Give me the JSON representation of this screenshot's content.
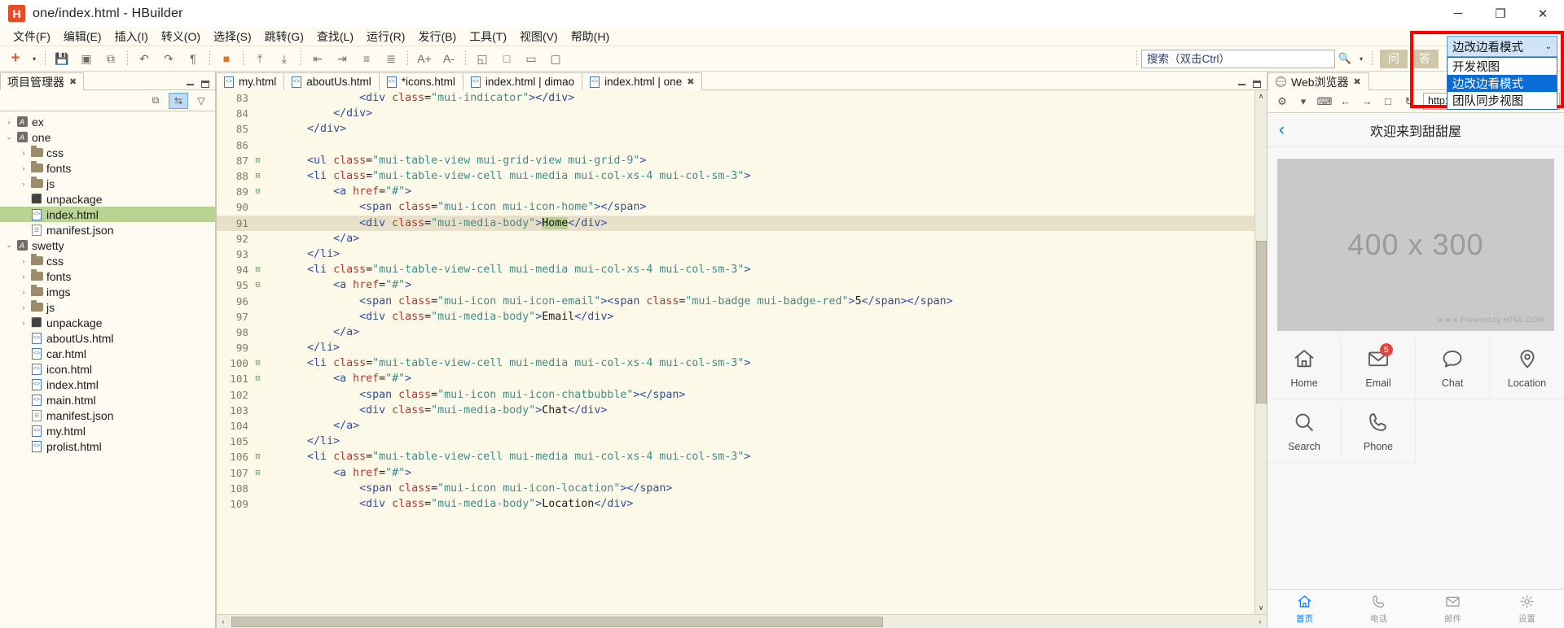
{
  "window": {
    "logo_text": "H",
    "title": "one/index.html  -  HBuilder",
    "minimize": "─",
    "maximize": "❐",
    "close": "✕"
  },
  "menubar": {
    "items": [
      "文件(F)",
      "编辑(E)",
      "插入(I)",
      "转义(O)",
      "选择(S)",
      "跳转(G)",
      "查找(L)",
      "运行(R)",
      "发行(B)",
      "工具(T)",
      "视图(V)",
      "帮助(H)"
    ]
  },
  "toolbar": {
    "new_label": "+",
    "dropdown_caret": "▾",
    "buttons": [
      {
        "name": "save-button",
        "glyph": "💾"
      },
      {
        "name": "save-all-button",
        "glyph": "▣"
      },
      {
        "name": "save-as-button",
        "glyph": "⧉"
      },
      {
        "name": "undo-button",
        "glyph": "↶"
      },
      {
        "name": "redo-button",
        "glyph": "↷"
      },
      {
        "name": "format-button",
        "glyph": "¶"
      },
      {
        "name": "bookmark-button",
        "glyph": "■"
      },
      {
        "name": "goto-prev-bookmark-button",
        "glyph": "⤒"
      },
      {
        "name": "goto-next-bookmark-button",
        "glyph": "⤓"
      },
      {
        "name": "outdent-button",
        "glyph": "⇤"
      },
      {
        "name": "indent-button",
        "glyph": "⇥"
      },
      {
        "name": "comment-button",
        "glyph": "≡"
      },
      {
        "name": "uncomment-button",
        "glyph": "≣"
      },
      {
        "name": "font-increase-button",
        "glyph": "A+"
      },
      {
        "name": "font-decrease-button",
        "glyph": "A-"
      },
      {
        "name": "browser-run-button",
        "glyph": "◱"
      },
      {
        "name": "preview-button",
        "glyph": "□"
      },
      {
        "name": "mobile-run-button",
        "glyph": "▭"
      },
      {
        "name": "device-button",
        "glyph": "▢"
      }
    ],
    "search_placeholder": "搜索（双击Ctrl）",
    "search_value": "搜索（双击Ctrl）",
    "search_icon": "🔍",
    "search_caret": "▾",
    "right_buttons": [
      "问",
      "答"
    ]
  },
  "mode_dropdown": {
    "selected": "边改边看模式",
    "caret": "⌄",
    "options": [
      "开发视图",
      "边改边看模式",
      "团队同步视图"
    ],
    "selected_index": 1,
    "highlight_color": "#0a6cd6",
    "annotation_color": "#ff0000"
  },
  "left_panel": {
    "tab_title": "项目管理器",
    "tab_close": "✖",
    "toolbar_buttons": [
      {
        "name": "collapse-all-button",
        "glyph": "⧉"
      },
      {
        "name": "link-with-editor-button",
        "glyph": "⇆",
        "active": true
      },
      {
        "name": "view-menu-button",
        "glyph": "▽"
      }
    ],
    "tree": [
      {
        "depth": 0,
        "twisty": "›",
        "icon": "project",
        "label": "ex",
        "selected": false
      },
      {
        "depth": 0,
        "twisty": "⌄",
        "icon": "project",
        "label": "one",
        "selected": false
      },
      {
        "depth": 1,
        "twisty": "›",
        "icon": "folder",
        "label": "css",
        "selected": false
      },
      {
        "depth": 1,
        "twisty": "›",
        "icon": "folder",
        "label": "fonts",
        "selected": false
      },
      {
        "depth": 1,
        "twisty": "›",
        "icon": "folder",
        "label": "js",
        "selected": false
      },
      {
        "depth": 1,
        "twisty": "",
        "icon": "box",
        "label": "unpackage",
        "selected": false
      },
      {
        "depth": 1,
        "twisty": "",
        "icon": "html",
        "label": "index.html",
        "selected": true
      },
      {
        "depth": 1,
        "twisty": "",
        "icon": "json",
        "label": "manifest.json",
        "selected": false
      },
      {
        "depth": 0,
        "twisty": "⌄",
        "icon": "project",
        "label": "swetty",
        "selected": false
      },
      {
        "depth": 1,
        "twisty": "›",
        "icon": "folder",
        "label": "css",
        "selected": false
      },
      {
        "depth": 1,
        "twisty": "›",
        "icon": "folder",
        "label": "fonts",
        "selected": false
      },
      {
        "depth": 1,
        "twisty": "›",
        "icon": "folder",
        "label": "imgs",
        "selected": false
      },
      {
        "depth": 1,
        "twisty": "›",
        "icon": "folder",
        "label": "js",
        "selected": false
      },
      {
        "depth": 1,
        "twisty": "›",
        "icon": "box",
        "label": "unpackage",
        "selected": false
      },
      {
        "depth": 1,
        "twisty": "",
        "icon": "html",
        "label": "aboutUs.html",
        "selected": false
      },
      {
        "depth": 1,
        "twisty": "",
        "icon": "html",
        "label": "car.html",
        "selected": false
      },
      {
        "depth": 1,
        "twisty": "",
        "icon": "html",
        "label": "icon.html",
        "selected": false
      },
      {
        "depth": 1,
        "twisty": "",
        "icon": "html",
        "label": "index.html",
        "selected": false
      },
      {
        "depth": 1,
        "twisty": "",
        "icon": "html",
        "label": "main.html",
        "selected": false
      },
      {
        "depth": 1,
        "twisty": "",
        "icon": "json",
        "label": "manifest.json",
        "selected": false
      },
      {
        "depth": 1,
        "twisty": "",
        "icon": "html",
        "label": "my.html",
        "selected": false
      },
      {
        "depth": 1,
        "twisty": "",
        "icon": "html",
        "label": "prolist.html",
        "selected": false
      }
    ]
  },
  "editor": {
    "tabs": [
      {
        "label": "my.html",
        "active": false,
        "closable": false
      },
      {
        "label": "aboutUs.html",
        "active": false,
        "closable": false
      },
      {
        "label": "*icons.html",
        "active": false,
        "closable": false
      },
      {
        "label": "index.html | dimao",
        "active": false,
        "closable": false
      },
      {
        "label": "index.html | one",
        "active": true,
        "closable": true
      }
    ],
    "tab_close": "✖",
    "lines": [
      {
        "n": "83",
        "fold": "",
        "indent": 7,
        "hl": false,
        "tokens": [
          [
            "tag",
            "<div "
          ],
          [
            "attr",
            "class"
          ],
          [
            "txt",
            "="
          ],
          [
            "val",
            "\"mui-indicator\""
          ],
          [
            "tag",
            "></div>"
          ]
        ]
      },
      {
        "n": "84",
        "fold": "",
        "indent": 5,
        "hl": false,
        "tokens": [
          [
            "tag",
            "</div>"
          ]
        ]
      },
      {
        "n": "85",
        "fold": "",
        "indent": 3,
        "hl": false,
        "tokens": [
          [
            "tag",
            "</div>"
          ]
        ]
      },
      {
        "n": "86",
        "fold": "",
        "indent": 0,
        "hl": false,
        "tokens": []
      },
      {
        "n": "87",
        "fold": "⊟",
        "indent": 3,
        "hl": false,
        "tokens": [
          [
            "tag",
            "<ul "
          ],
          [
            "attr",
            "class"
          ],
          [
            "txt",
            "="
          ],
          [
            "val",
            "\"mui-table-view mui-grid-view mui-grid-9\""
          ],
          [
            "tag",
            ">"
          ]
        ]
      },
      {
        "n": "88",
        "fold": "⊟",
        "indent": 3,
        "hl": false,
        "tokens": [
          [
            "tag",
            "<li "
          ],
          [
            "attr",
            "class"
          ],
          [
            "txt",
            "="
          ],
          [
            "val",
            "\"mui-table-view-cell mui-media mui-col-xs-4 mui-col-sm-3\""
          ],
          [
            "tag",
            ">"
          ]
        ]
      },
      {
        "n": "89",
        "fold": "⊟",
        "indent": 5,
        "hl": false,
        "tokens": [
          [
            "tag",
            "<a "
          ],
          [
            "attr",
            "href"
          ],
          [
            "txt",
            "="
          ],
          [
            "val",
            "\"#\""
          ],
          [
            "tag",
            ">"
          ]
        ]
      },
      {
        "n": "90",
        "fold": "",
        "indent": 7,
        "hl": false,
        "tokens": [
          [
            "tag",
            "<span "
          ],
          [
            "attr",
            "class"
          ],
          [
            "txt",
            "="
          ],
          [
            "val",
            "\"mui-icon mui-icon-home\""
          ],
          [
            "tag",
            "></span>"
          ]
        ]
      },
      {
        "n": "91",
        "fold": "",
        "indent": 7,
        "hl": true,
        "tokens": [
          [
            "tag",
            "<div "
          ],
          [
            "attr",
            "class"
          ],
          [
            "txt",
            "="
          ],
          [
            "val",
            "\"mui-media-body\""
          ],
          [
            "tag",
            ">"
          ],
          [
            "sel",
            "Home"
          ],
          [
            "tag",
            "</div>"
          ]
        ]
      },
      {
        "n": "92",
        "fold": "",
        "indent": 5,
        "hl": false,
        "tokens": [
          [
            "tag",
            "</a>"
          ]
        ]
      },
      {
        "n": "93",
        "fold": "",
        "indent": 3,
        "hl": false,
        "tokens": [
          [
            "tag",
            "</li>"
          ]
        ]
      },
      {
        "n": "94",
        "fold": "⊟",
        "indent": 3,
        "hl": false,
        "tokens": [
          [
            "tag",
            "<li "
          ],
          [
            "attr",
            "class"
          ],
          [
            "txt",
            "="
          ],
          [
            "val",
            "\"mui-table-view-cell mui-media mui-col-xs-4 mui-col-sm-3\""
          ],
          [
            "tag",
            ">"
          ]
        ]
      },
      {
        "n": "95",
        "fold": "⊟",
        "indent": 5,
        "hl": false,
        "tokens": [
          [
            "tag",
            "<a "
          ],
          [
            "attr",
            "href"
          ],
          [
            "txt",
            "="
          ],
          [
            "val",
            "\"#\""
          ],
          [
            "tag",
            ">"
          ]
        ]
      },
      {
        "n": "96",
        "fold": "",
        "indent": 7,
        "hl": false,
        "tokens": [
          [
            "tag",
            "<span "
          ],
          [
            "attr",
            "class"
          ],
          [
            "txt",
            "="
          ],
          [
            "val",
            "\"mui-icon mui-icon-email\""
          ],
          [
            "tag",
            "><span "
          ],
          [
            "attr",
            "class"
          ],
          [
            "txt",
            "="
          ],
          [
            "val",
            "\"mui-badge mui-badge-red\""
          ],
          [
            "tag",
            ">"
          ],
          [
            "txt",
            "5"
          ],
          [
            "tag",
            "</span></span>"
          ]
        ]
      },
      {
        "n": "97",
        "fold": "",
        "indent": 7,
        "hl": false,
        "tokens": [
          [
            "tag",
            "<div "
          ],
          [
            "attr",
            "class"
          ],
          [
            "txt",
            "="
          ],
          [
            "val",
            "\"mui-media-body\""
          ],
          [
            "tag",
            ">"
          ],
          [
            "txt",
            "Email"
          ],
          [
            "tag",
            "</div>"
          ]
        ]
      },
      {
        "n": "98",
        "fold": "",
        "indent": 5,
        "hl": false,
        "tokens": [
          [
            "tag",
            "</a>"
          ]
        ]
      },
      {
        "n": "99",
        "fold": "",
        "indent": 3,
        "hl": false,
        "tokens": [
          [
            "tag",
            "</li>"
          ]
        ]
      },
      {
        "n": "100",
        "fold": "⊟",
        "indent": 3,
        "hl": false,
        "tokens": [
          [
            "tag",
            "<li "
          ],
          [
            "attr",
            "class"
          ],
          [
            "txt",
            "="
          ],
          [
            "val",
            "\"mui-table-view-cell mui-media mui-col-xs-4 mui-col-sm-3\""
          ],
          [
            "tag",
            ">"
          ]
        ]
      },
      {
        "n": "101",
        "fold": "⊟",
        "indent": 5,
        "hl": false,
        "tokens": [
          [
            "tag",
            "<a "
          ],
          [
            "attr",
            "href"
          ],
          [
            "txt",
            "="
          ],
          [
            "val",
            "\"#\""
          ],
          [
            "tag",
            ">"
          ]
        ]
      },
      {
        "n": "102",
        "fold": "",
        "indent": 7,
        "hl": false,
        "tokens": [
          [
            "tag",
            "<span "
          ],
          [
            "attr",
            "class"
          ],
          [
            "txt",
            "="
          ],
          [
            "val",
            "\"mui-icon mui-icon-chatbubble\""
          ],
          [
            "tag",
            "></span>"
          ]
        ]
      },
      {
        "n": "103",
        "fold": "",
        "indent": 7,
        "hl": false,
        "tokens": [
          [
            "tag",
            "<div "
          ],
          [
            "attr",
            "class"
          ],
          [
            "txt",
            "="
          ],
          [
            "val",
            "\"mui-media-body\""
          ],
          [
            "tag",
            ">"
          ],
          [
            "txt",
            "Chat"
          ],
          [
            "tag",
            "</div>"
          ]
        ]
      },
      {
        "n": "104",
        "fold": "",
        "indent": 5,
        "hl": false,
        "tokens": [
          [
            "tag",
            "</a>"
          ]
        ]
      },
      {
        "n": "105",
        "fold": "",
        "indent": 3,
        "hl": false,
        "tokens": [
          [
            "tag",
            "</li>"
          ]
        ]
      },
      {
        "n": "106",
        "fold": "⊟",
        "indent": 3,
        "hl": false,
        "tokens": [
          [
            "tag",
            "<li "
          ],
          [
            "attr",
            "class"
          ],
          [
            "txt",
            "="
          ],
          [
            "val",
            "\"mui-table-view-cell mui-media mui-col-xs-4 mui-col-sm-3\""
          ],
          [
            "tag",
            ">"
          ]
        ]
      },
      {
        "n": "107",
        "fold": "⊟",
        "indent": 5,
        "hl": false,
        "tokens": [
          [
            "tag",
            "<a "
          ],
          [
            "attr",
            "href"
          ],
          [
            "txt",
            "="
          ],
          [
            "val",
            "\"#\""
          ],
          [
            "tag",
            ">"
          ]
        ]
      },
      {
        "n": "108",
        "fold": "",
        "indent": 7,
        "hl": false,
        "tokens": [
          [
            "tag",
            "<span "
          ],
          [
            "attr",
            "class"
          ],
          [
            "txt",
            "="
          ],
          [
            "val",
            "\"mui-icon mui-icon-location\""
          ],
          [
            "tag",
            "></span>"
          ]
        ]
      },
      {
        "n": "109",
        "fold": "",
        "indent": 7,
        "hl": false,
        "tokens": [
          [
            "tag",
            "<div "
          ],
          [
            "attr",
            "class"
          ],
          [
            "txt",
            "="
          ],
          [
            "val",
            "\"mui-media-body\""
          ],
          [
            "tag",
            ">"
          ],
          [
            "txt",
            "Location"
          ],
          [
            "tag",
            "</div>"
          ]
        ]
      }
    ],
    "scroll_up": "∧",
    "scroll_down": "∨",
    "scroll_left": "‹",
    "scroll_right": "›"
  },
  "right_panel": {
    "tab_title": "Web浏览器",
    "tab_close": "✖",
    "toolbar": [
      {
        "name": "settings-gear-icon",
        "glyph": "⚙"
      },
      {
        "name": "chevron-down-icon",
        "glyph": "▾"
      },
      {
        "name": "console-icon",
        "glyph": "⌨"
      },
      {
        "name": "back-arrow-icon",
        "glyph": "←"
      },
      {
        "name": "forward-arrow-icon",
        "glyph": "→"
      },
      {
        "name": "stop-icon",
        "glyph": "□"
      },
      {
        "name": "refresh-icon",
        "glyph": "↻"
      }
    ],
    "url": "http://127.0.0.1"
  },
  "preview": {
    "back_chevron": "‹",
    "header_title": "欢迎来到甜甜屋",
    "placeholder_text": "400 x 300",
    "placeholder_footer": "Powered by HTML.COM",
    "grid": [
      {
        "icon": "home",
        "label": "Home",
        "badge": null
      },
      {
        "icon": "email",
        "label": "Email",
        "badge": "5"
      },
      {
        "icon": "chat",
        "label": "Chat",
        "badge": null
      },
      {
        "icon": "location",
        "label": "Location",
        "badge": null
      },
      {
        "icon": "search",
        "label": "Search",
        "badge": null
      },
      {
        "icon": "phone",
        "label": "Phone",
        "badge": null
      }
    ],
    "tabbar": [
      {
        "icon": "home",
        "label": "首页",
        "active": true
      },
      {
        "icon": "phone",
        "label": "电话",
        "active": false
      },
      {
        "icon": "email",
        "label": "邮件",
        "active": false
      },
      {
        "icon": "gear",
        "label": "设置",
        "active": false
      }
    ],
    "accent_color": "#007aff",
    "badge_color": "#e64340"
  }
}
